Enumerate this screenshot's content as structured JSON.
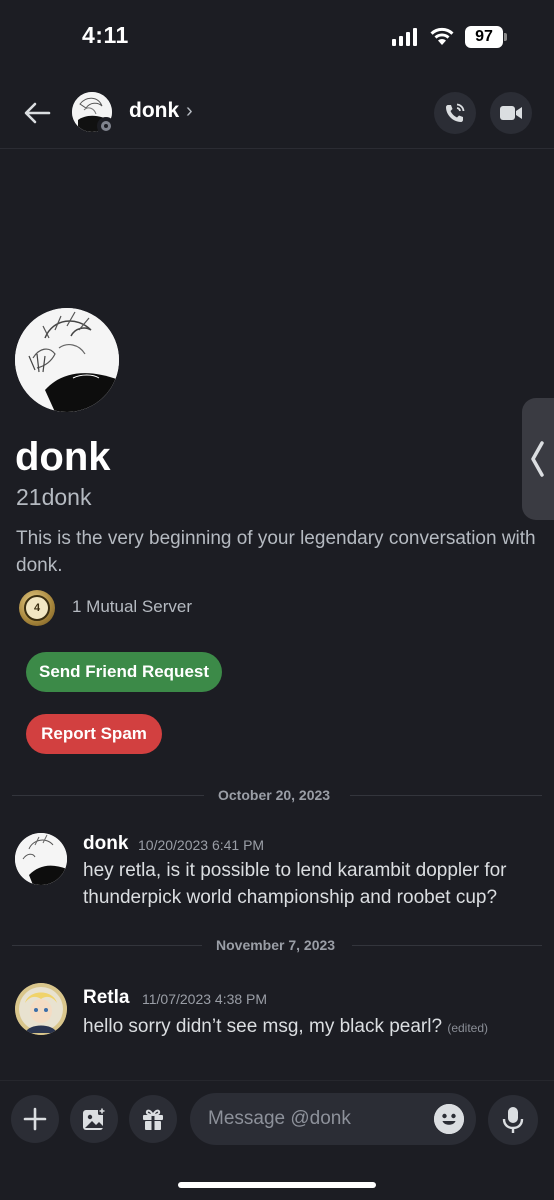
{
  "status_bar": {
    "time": "4:11",
    "battery": "97"
  },
  "header": {
    "name": "donk",
    "chevron": "›"
  },
  "profile": {
    "display_name": "donk",
    "username": "21donk",
    "intro": "This is the very beginning of your legendary conversation with donk.",
    "mutual_servers": "1 Mutual Server",
    "mutual_icon_text": "4",
    "send_friend_request": "Send Friend Request",
    "report_spam": "Report Spam"
  },
  "dividers": [
    "October 20, 2023",
    "November 7, 2023"
  ],
  "messages": [
    {
      "author": "donk",
      "timestamp": "10/20/2023 6:41 PM",
      "text": "hey retla, is it possible to lend karambit doppler for thunderpick world championship and roobet cup?"
    },
    {
      "author": "Retla",
      "timestamp": "11/07/2023 4:38 PM",
      "text": "hello sorry didn’t see msg, my black pearl?",
      "edited": "(edited)"
    }
  ],
  "composer": {
    "placeholder": "Message @donk"
  },
  "colors": {
    "friend_button": "#3c8a48",
    "spam_button": "#d24040",
    "background": "#1c1d23"
  }
}
